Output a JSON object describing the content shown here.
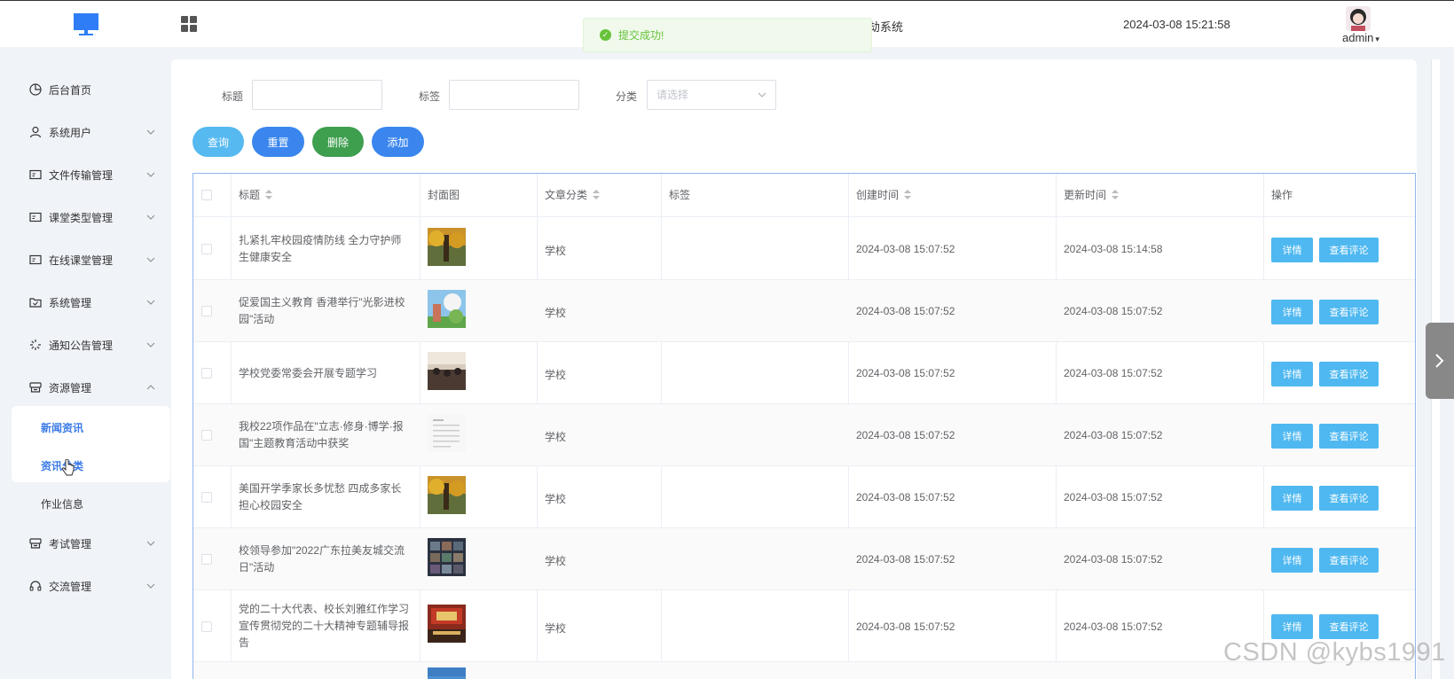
{
  "header": {
    "system_title_fragment": "劫系统",
    "datetime": "2024-03-08 15:21:58",
    "username": "admin",
    "caret": "▾"
  },
  "toast": {
    "message": "提交成功!"
  },
  "sidebar": {
    "items": [
      {
        "label": "后台首页"
      },
      {
        "label": "系统用户"
      },
      {
        "label": "文件传输管理"
      },
      {
        "label": "课堂类型管理"
      },
      {
        "label": "在线课堂管理"
      },
      {
        "label": "系统管理"
      },
      {
        "label": "通知公告管理"
      },
      {
        "label": "资源管理"
      },
      {
        "label": "考试管理"
      },
      {
        "label": "交流管理"
      }
    ],
    "subitems": [
      {
        "label": "新闻资讯"
      },
      {
        "label": "资讯分类"
      },
      {
        "label": "作业信息"
      }
    ]
  },
  "filters": {
    "title_label": "标题",
    "tag_label": "标签",
    "category_label": "分类",
    "title_value": "",
    "tag_value": "",
    "category_placeholder": "请选择"
  },
  "buttons": {
    "query": "查询",
    "reset": "重置",
    "delete": "删除",
    "add": "添加"
  },
  "colors": {
    "query": "#56b9f0",
    "reset": "#3a86ee",
    "delete": "#3e9f4f",
    "add": "#3a86ee",
    "row_button": "#4fb8f0",
    "toast": "#67c23a"
  },
  "table": {
    "columns": [
      "标题",
      "封面图",
      "文章分类",
      "标签",
      "创建时间",
      "更新时间",
      "操作"
    ],
    "detail_label": "详情",
    "comments_label": "查看评论",
    "rows": [
      {
        "title": "扎紧扎牢校园疫情防线 全力守护师生健康安全",
        "category": "学校",
        "tag": "",
        "created": "2024-03-08 15:07:52",
        "updated": "2024-03-08 15:14:58"
      },
      {
        "title": "促爱国主义教育 香港举行\"光影进校园\"活动",
        "category": "学校",
        "tag": "",
        "created": "2024-03-08 15:07:52",
        "updated": "2024-03-08 15:07:52"
      },
      {
        "title": "学校党委常委会开展专题学习",
        "category": "学校",
        "tag": "",
        "created": "2024-03-08 15:07:52",
        "updated": "2024-03-08 15:07:52"
      },
      {
        "title": "我校22项作品在\"立志·修身·博学·报国\"主题教育活动中获奖",
        "category": "学校",
        "tag": "",
        "created": "2024-03-08 15:07:52",
        "updated": "2024-03-08 15:07:52"
      },
      {
        "title": "美国开学季家长多忧愁 四成多家长担心校园安全",
        "category": "学校",
        "tag": "",
        "created": "2024-03-08 15:07:52",
        "updated": "2024-03-08 15:07:52"
      },
      {
        "title": "校领导参加\"2022广东拉美友城交流日\"活动",
        "category": "学校",
        "tag": "",
        "created": "2024-03-08 15:07:52",
        "updated": "2024-03-08 15:07:52"
      },
      {
        "title": "党的二十大代表、校长刘雅红作学习宣传贯彻党的二十大精神专题辅导报告",
        "category": "学校",
        "tag": "",
        "created": "2024-03-08 15:07:52",
        "updated": "2024-03-08 15:07:52"
      }
    ]
  },
  "watermark": "CSDN @kybs1991"
}
